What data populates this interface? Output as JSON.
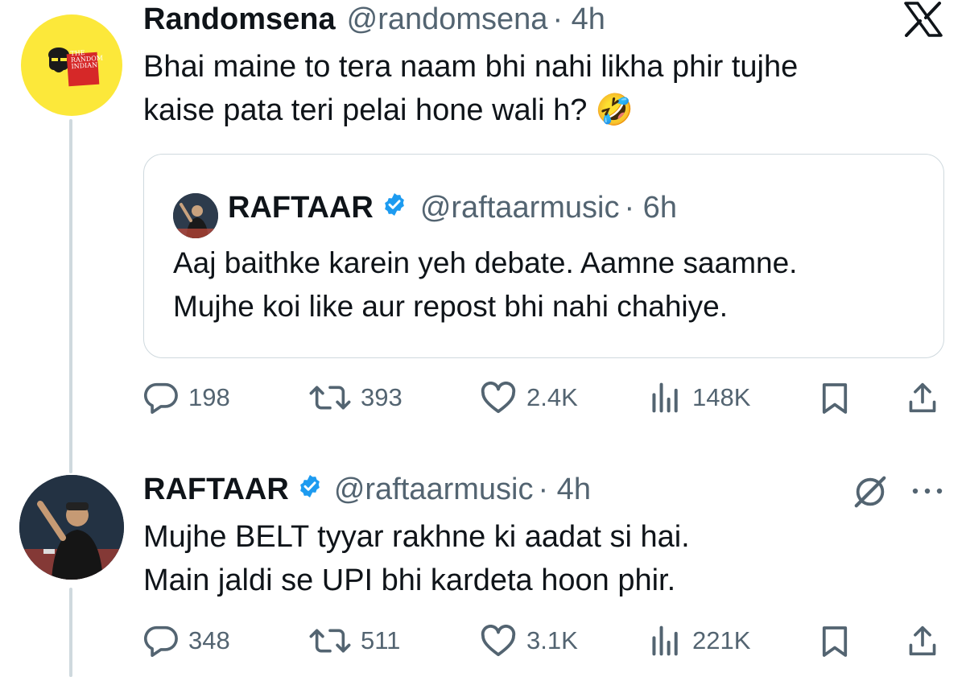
{
  "colors": {
    "text": "#0f1419",
    "muted": "#536471",
    "border": "#cfd9de",
    "verified": "#1d9bf0",
    "avatar_yellow": "#fce83a"
  },
  "tweet1": {
    "name": "Randomsena",
    "handle": "@randomsena",
    "time": "· 4h",
    "avatar_text": [
      "THE",
      "RANDOM",
      "INDIAN"
    ],
    "text_line1": "Bhai maine to tera naam bhi nahi likha phir tujhe",
    "text_line2": "kaise pata teri pelai hone wali h? 🤣",
    "quote": {
      "name": "RAFTAAR",
      "handle": "@raftaarmusic",
      "time": "· 6h",
      "text_line1": "Aaj baithke karein yeh debate. Aamne saamne.",
      "text_line2": "Mujhe koi like aur repost bhi nahi chahiye."
    },
    "stats": {
      "replies": "198",
      "reposts": "393",
      "likes": "2.4K",
      "views": "148K"
    }
  },
  "tweet2": {
    "name": "RAFTAAR",
    "handle": "@raftaarmusic",
    "time": "· 4h",
    "text_line1": "Mujhe BELT tyyar rakhne ki aadat si hai.",
    "text_line2": "Main jaldi se UPI bhi kardeta hoon phir.",
    "stats": {
      "replies": "348",
      "reposts": "511",
      "likes": "3.1K",
      "views": "221K"
    }
  },
  "icons": [
    "x-logo-icon",
    "verified-badge-icon",
    "reply-icon",
    "repost-icon",
    "like-icon",
    "views-icon",
    "bookmark-icon",
    "share-icon",
    "grok-icon",
    "more-icon"
  ]
}
